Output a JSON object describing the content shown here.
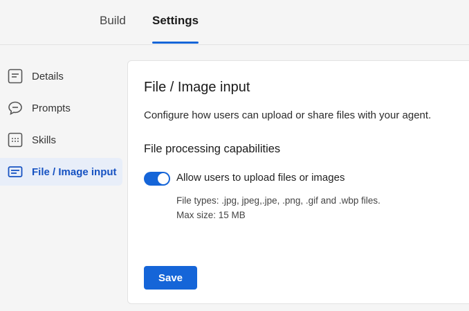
{
  "tabs": [
    {
      "label": "Build",
      "active": false
    },
    {
      "label": "Settings",
      "active": true
    }
  ],
  "sidebar": {
    "items": [
      {
        "label": "Details",
        "icon": "details-icon",
        "active": false
      },
      {
        "label": "Prompts",
        "icon": "chat-bubble-icon",
        "active": false
      },
      {
        "label": "Skills",
        "icon": "grid-icon",
        "active": false
      },
      {
        "label": "File / Image input",
        "icon": "keyboard-icon",
        "active": true
      }
    ]
  },
  "main": {
    "title": "File / Image input",
    "description": "Configure how users can upload or share files with your agent.",
    "section_title": "File processing capabilities",
    "toggle": {
      "label": "Allow users to upload files or images",
      "enabled": true
    },
    "file_types": "File types: .jpg, jpeg,.jpe, .png, .gif and .wbp files.",
    "max_size": "Max size: 15 MB",
    "save_label": "Save"
  },
  "colors": {
    "accent": "#1565d8",
    "active_bg": "#e8eef9",
    "page_bg": "#f5f5f5"
  }
}
